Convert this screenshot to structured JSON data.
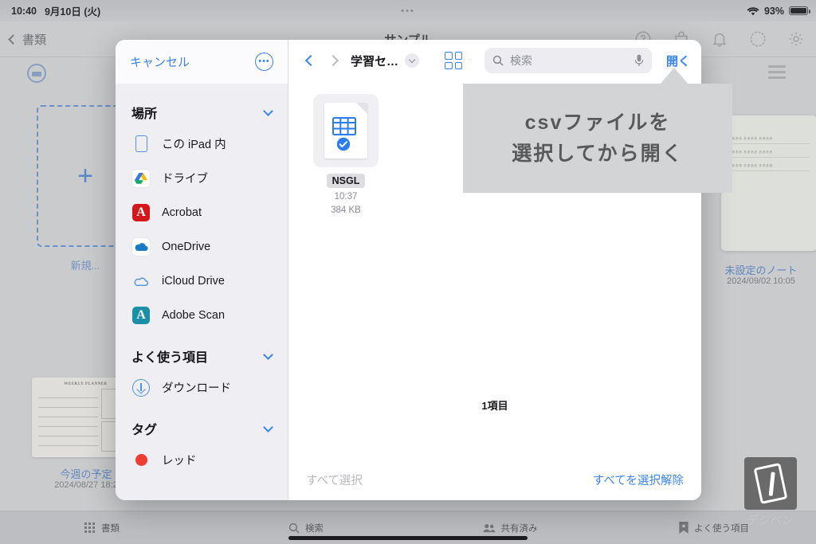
{
  "status_bar": {
    "time": "10:40",
    "date": "9月10日 (火)",
    "center_dots": "•••",
    "wifi_icon": "wifi-icon",
    "battery_percent": "93%",
    "battery_level": 93
  },
  "background_app": {
    "back_label": "書類",
    "title": "サンプル",
    "toolbar_icons": [
      "help-circle-icon",
      "bag-icon",
      "bell-icon",
      "check-circle-icon",
      "gear-icon"
    ],
    "view_icon": "list-view-icon",
    "cards": [
      {
        "label": "新規...",
        "type": "new-placeholder",
        "plus": "+"
      },
      {
        "label": "今週の予定",
        "date": "2024/08/27 18:2",
        "type": "weekly-planner",
        "thumb_title": "WEEKLY PLANNER"
      },
      {
        "label": "未設定のノート",
        "date": "2024/09/02 10:05",
        "type": "note"
      }
    ],
    "tabs": [
      {
        "label": "書類",
        "icon": "grid-icon"
      },
      {
        "label": "検索",
        "icon": "search-icon"
      },
      {
        "label": "共有済み",
        "icon": "people-icon"
      },
      {
        "label": "よく使う項目",
        "icon": "bookmark-icon"
      }
    ],
    "logo": {
      "label": "デジペン",
      "icon": "tablet-pen-icon"
    }
  },
  "picker": {
    "sidebar": {
      "cancel_label": "キャンセル",
      "more_icon": "ellipsis-circle-icon",
      "sections": [
        {
          "title": "場所",
          "chevron": "chevron-down-icon",
          "items": [
            {
              "label": "この iPad 内",
              "icon": "ipad-icon"
            },
            {
              "label": "ドライブ",
              "icon": "google-drive-icon"
            },
            {
              "label": "Acrobat",
              "icon": "acrobat-icon"
            },
            {
              "label": "OneDrive",
              "icon": "onedrive-icon"
            },
            {
              "label": "iCloud Drive",
              "icon": "icloud-drive-icon"
            },
            {
              "label": "Adobe Scan",
              "icon": "adobe-scan-icon"
            }
          ]
        },
        {
          "title": "よく使う項目",
          "chevron": "chevron-down-icon",
          "items": [
            {
              "label": "ダウンロード",
              "icon": "download-icon"
            }
          ]
        },
        {
          "title": "タグ",
          "chevron": "chevron-down-icon",
          "items": [
            {
              "label": "レッド",
              "icon": "red-tag-dot",
              "color": "#f13c33"
            }
          ]
        }
      ]
    },
    "toolbar": {
      "back_icon": "chevron-left-icon",
      "forward_icon": "chevron-right-icon",
      "path_title": "学習セ…",
      "path_chevron_icon": "chevron-down-circle-icon",
      "grid_icon": "grid-view-icon",
      "search_placeholder": "検索",
      "search_icon": "search-icon",
      "mic_icon": "microphone-icon",
      "open_label": "開く"
    },
    "files": [
      {
        "name": "NSGL",
        "time": "10:37",
        "size": "384 KB",
        "icon": "csv-spreadsheet-icon",
        "selected": true,
        "check_icon": "check-circle-icon"
      }
    ],
    "item_count_label": "1項目",
    "select_all_label": "すべて選択",
    "deselect_all_label": "すべてを選択解除"
  },
  "callout": {
    "line1": "csvファイルを",
    "line2": "選択してから開く"
  },
  "colors": {
    "accent_blue": "#3a84f2",
    "callout_bg": "#d3d4d6",
    "callout_text": "#58595b",
    "sidebar_bg": "#eeeef3",
    "selected_badge": "#dcdce1"
  }
}
